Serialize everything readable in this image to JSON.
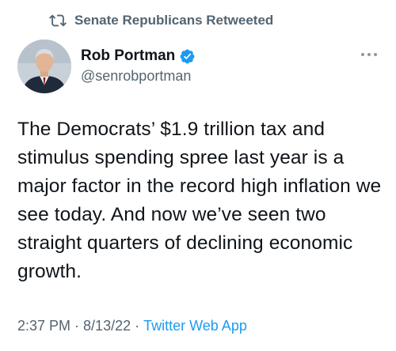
{
  "retweet": {
    "label": "Senate Republicans Retweeted"
  },
  "author": {
    "display_name": "Rob Portman",
    "handle": "@senrobportman",
    "verified": true
  },
  "tweet": {
    "text": "The Democrats’ $1.9 trillion tax and stimulus spending spree last year is a major factor in the record high inflation we see today. And now we’ve seen two straight quarters of declining economic growth."
  },
  "meta": {
    "time": "2:37 PM",
    "separator": "·",
    "date": "8/13/22",
    "source": "Twitter Web App"
  },
  "colors": {
    "text_primary": "#0f1419",
    "text_secondary": "#536471",
    "accent": "#1d9bf0"
  },
  "icons": {
    "retweet": "retweet-icon",
    "verified": "verified-badge-icon",
    "more": "more-options-icon"
  }
}
